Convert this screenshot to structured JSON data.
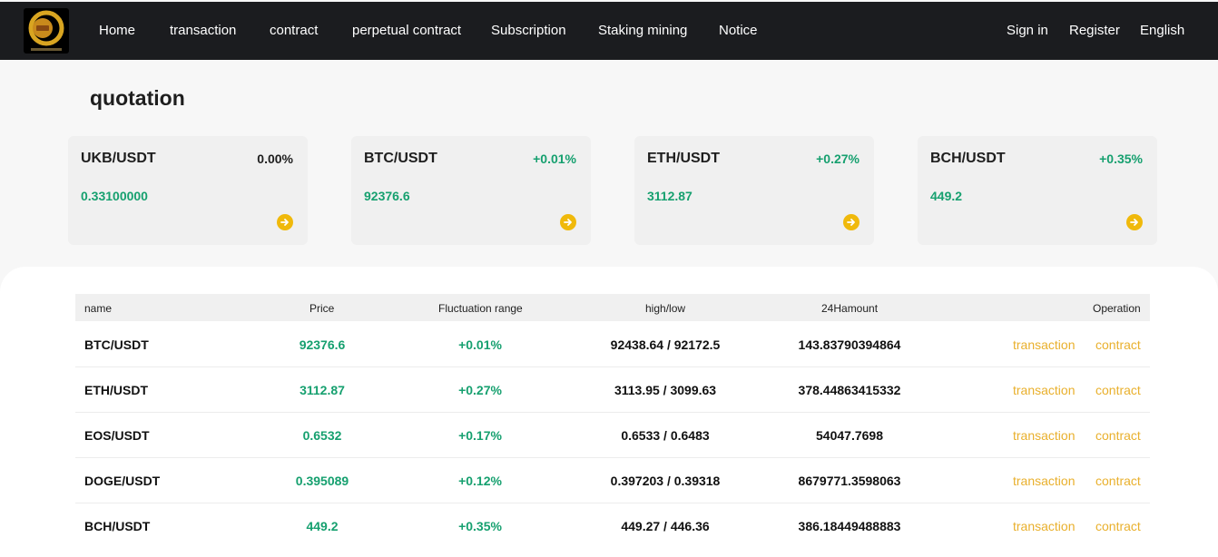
{
  "nav": {
    "items": [
      "Home",
      "transaction",
      "contract",
      "perpetual contract",
      "Subscription",
      "Staking mining",
      "Notice"
    ],
    "sign_in": "Sign in",
    "register": "Register",
    "language": "English"
  },
  "headline": "quotation",
  "cards": [
    {
      "symbol": "UKB/USDT",
      "change": "0.00%",
      "price": "0.33100000",
      "change_color": "#1e1e1e"
    },
    {
      "symbol": "BTC/USDT",
      "change": "+0.01%",
      "price": "92376.6",
      "change_color": "#16a06f"
    },
    {
      "symbol": "ETH/USDT",
      "change": "+0.27%",
      "price": "3112.87",
      "change_color": "#16a06f"
    },
    {
      "symbol": "BCH/USDT",
      "change": "+0.35%",
      "price": "449.2",
      "change_color": "#16a06f"
    }
  ],
  "table": {
    "headers": {
      "name": "name",
      "price": "Price",
      "change": "Fluctuation range",
      "highlow": "high/low",
      "amount": "24Hamount",
      "operation": "Operation"
    },
    "rows": [
      {
        "name": "BTC/USDT",
        "price": "92376.6",
        "change": "+0.01%",
        "highlow": "92438.64 / 92172.5",
        "amount": "143.83790394864",
        "transaction": "transaction",
        "contract": "contract"
      },
      {
        "name": "ETH/USDT",
        "price": "3112.87",
        "change": "+0.27%",
        "highlow": "3113.95 / 3099.63",
        "amount": "378.44863415332",
        "transaction": "transaction",
        "contract": "contract"
      },
      {
        "name": "EOS/USDT",
        "price": "0.6532",
        "change": "+0.17%",
        "highlow": "0.6533 / 0.6483",
        "amount": "54047.7698",
        "transaction": "transaction",
        "contract": "contract"
      },
      {
        "name": "DOGE/USDT",
        "price": "0.395089",
        "change": "+0.12%",
        "highlow": "0.397203 / 0.39318",
        "amount": "8679771.3598063",
        "transaction": "transaction",
        "contract": "contract"
      },
      {
        "name": "BCH/USDT",
        "price": "449.2",
        "change": "+0.35%",
        "highlow": "449.27 / 446.36",
        "amount": "386.18449488883",
        "transaction": "transaction",
        "contract": "contract"
      }
    ]
  },
  "colors": {
    "up": "#16a06f",
    "accent": "#f0b90b",
    "link": "#e9b02d",
    "topbar": "#1b1c1f"
  },
  "icons": {
    "logo": "gold-coin-logo",
    "card_action": "arrow-right-circle-icon"
  }
}
